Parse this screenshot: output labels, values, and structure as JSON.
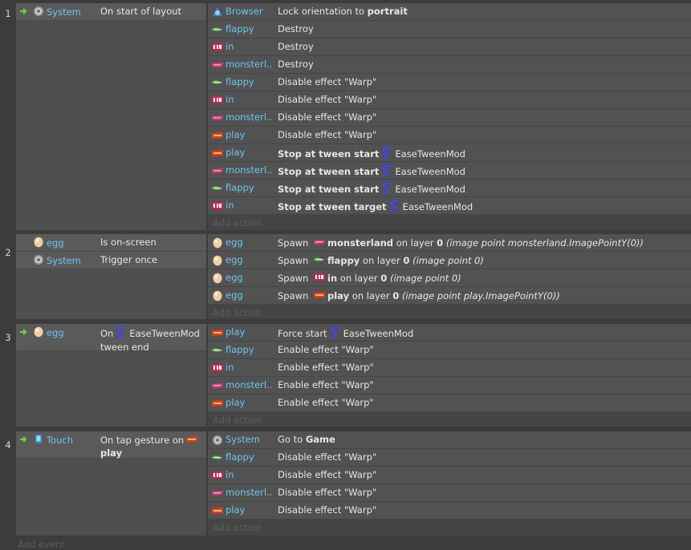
{
  "add_event_label": "Add event",
  "add_action_label": "Add action",
  "events": [
    {
      "number": "1",
      "conditions": [
        {
          "icon": "gear-icon",
          "object": "System",
          "text": "On start of layout"
        }
      ],
      "actions": [
        {
          "icon": "browser-icon",
          "object": "Browser",
          "text": "Lock orientation to ",
          "bold": "portrait"
        },
        {
          "icon": "flappy-icon",
          "object": "flappy",
          "text": "Destroy"
        },
        {
          "icon": "in-icon",
          "object": "in",
          "text": "Destroy"
        },
        {
          "icon": "monsterland-icon",
          "object": "monsterl...",
          "text": "Destroy"
        },
        {
          "icon": "flappy-icon",
          "object": "flappy",
          "text": "Disable effect \"Warp\""
        },
        {
          "icon": "in-icon",
          "object": "in",
          "text": "Disable effect \"Warp\""
        },
        {
          "icon": "monsterland-icon",
          "object": "monsterl...",
          "text": "Disable effect \"Warp\""
        },
        {
          "icon": "play-icon",
          "object": "play",
          "text": "Disable effect \"Warp\""
        },
        {
          "icon": "play-icon",
          "object": "play",
          "bold": "Stop at tween start",
          "behavior": "EaseTweenMod"
        },
        {
          "icon": "monsterland-icon",
          "object": "monsterl...",
          "bold": "Stop at tween start",
          "behavior": "EaseTweenMod"
        },
        {
          "icon": "flappy-icon",
          "object": "flappy",
          "bold": "Stop at tween start",
          "behavior": "EaseTweenMod"
        },
        {
          "icon": "in-icon",
          "object": "in",
          "bold": "Stop at tween target",
          "behavior": "EaseTweenMod"
        }
      ]
    },
    {
      "number": "2",
      "conditions": [
        {
          "icon": "egg-icon",
          "object": "egg",
          "text": "Is on-screen"
        },
        {
          "icon": "gear-icon",
          "object": "System",
          "text": "Trigger once"
        }
      ],
      "actions": [
        {
          "icon": "egg-icon",
          "object": "egg",
          "spawn": {
            "target_icon": "monsterland-icon",
            "target": "monsterland",
            "layer": "0",
            "point": "(image point monsterland.ImagePointY(0))"
          }
        },
        {
          "icon": "egg-icon",
          "object": "egg",
          "spawn": {
            "target_icon": "flappy-icon",
            "target": "flappy",
            "layer": "0",
            "point": "(image point 0)"
          }
        },
        {
          "icon": "egg-icon",
          "object": "egg",
          "spawn": {
            "target_icon": "in-icon",
            "target": "in",
            "layer": "0",
            "point": "(image point 0)"
          }
        },
        {
          "icon": "egg-icon",
          "object": "egg",
          "spawn": {
            "target_icon": "play-icon",
            "target": "play",
            "layer": "0",
            "point": "(image point play.ImagePointY(0))"
          }
        }
      ]
    },
    {
      "number": "3",
      "conditions": [
        {
          "icon": "egg-icon",
          "object": "egg",
          "text_prefix": "On",
          "behavior": "EaseTweenMod",
          "text_suffix": "tween end"
        }
      ],
      "actions": [
        {
          "icon": "play-icon",
          "object": "play",
          "text": "Force start",
          "behavior": "EaseTweenMod"
        },
        {
          "icon": "flappy-icon",
          "object": "flappy",
          "text": "Enable effect \"Warp\""
        },
        {
          "icon": "in-icon",
          "object": "in",
          "text": "Enable effect \"Warp\""
        },
        {
          "icon": "monsterland-icon",
          "object": "monsterl...",
          "text": "Enable effect \"Warp\""
        },
        {
          "icon": "play-icon",
          "object": "play",
          "text": "Enable effect \"Warp\""
        }
      ]
    },
    {
      "number": "4",
      "conditions": [
        {
          "icon": "touch-icon",
          "object": "Touch",
          "text_prefix": "On tap gesture on",
          "target_icon": "play-icon",
          "bold": "play"
        }
      ],
      "actions": [
        {
          "icon": "gear-icon",
          "object": "System",
          "text": "Go to ",
          "bold": "Game"
        },
        {
          "icon": "flappy-icon",
          "object": "flappy",
          "text": "Disable effect \"Warp\""
        },
        {
          "icon": "in-icon",
          "object": "in",
          "text": "Disable effect \"Warp\""
        },
        {
          "icon": "monsterland-icon",
          "object": "monsterl...",
          "text": "Disable effect \"Warp\""
        },
        {
          "icon": "play-icon",
          "object": "play",
          "text": "Disable effect \"Warp\""
        }
      ]
    }
  ],
  "colors": {
    "object_text": "#6cc6f0",
    "trigger_arrow": "#6fd13a",
    "condition_bg": "#5a5a5a",
    "action_bg": "#525252"
  }
}
